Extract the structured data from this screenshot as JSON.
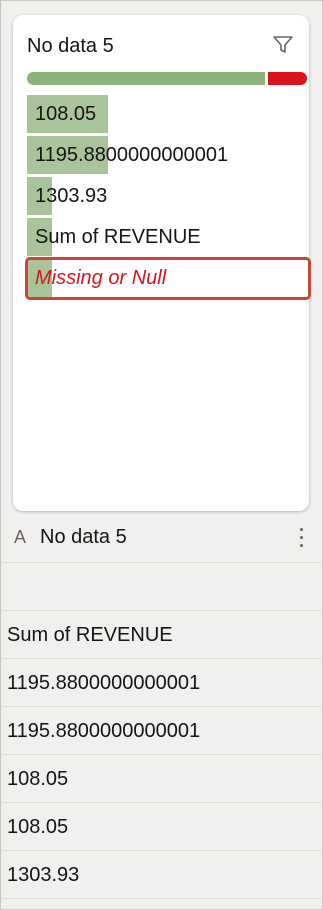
{
  "card": {
    "title": "No data 5",
    "quality": {
      "valid_fraction": 0.86,
      "invalid_fraction": 0.14,
      "valid_color": "#8ab27a",
      "invalid_color": "#d8141f"
    },
    "values": [
      {
        "label": "108.05",
        "fraction": 0.29
      },
      {
        "label": "1195.8800000000001",
        "fraction": 0.29
      },
      {
        "label": "1303.93",
        "fraction": 0.09
      },
      {
        "label": "Sum of REVENUE",
        "fraction": 0.09
      },
      {
        "label": "Missing or Null",
        "fraction": 0.09,
        "missing": true
      }
    ]
  },
  "column": {
    "type_icon": "A",
    "title": "No data 5",
    "rows": [
      "",
      "Sum of REVENUE",
      "1195.8800000000001",
      "1195.8800000000001",
      "108.05",
      "108.05",
      "1303.93"
    ]
  }
}
